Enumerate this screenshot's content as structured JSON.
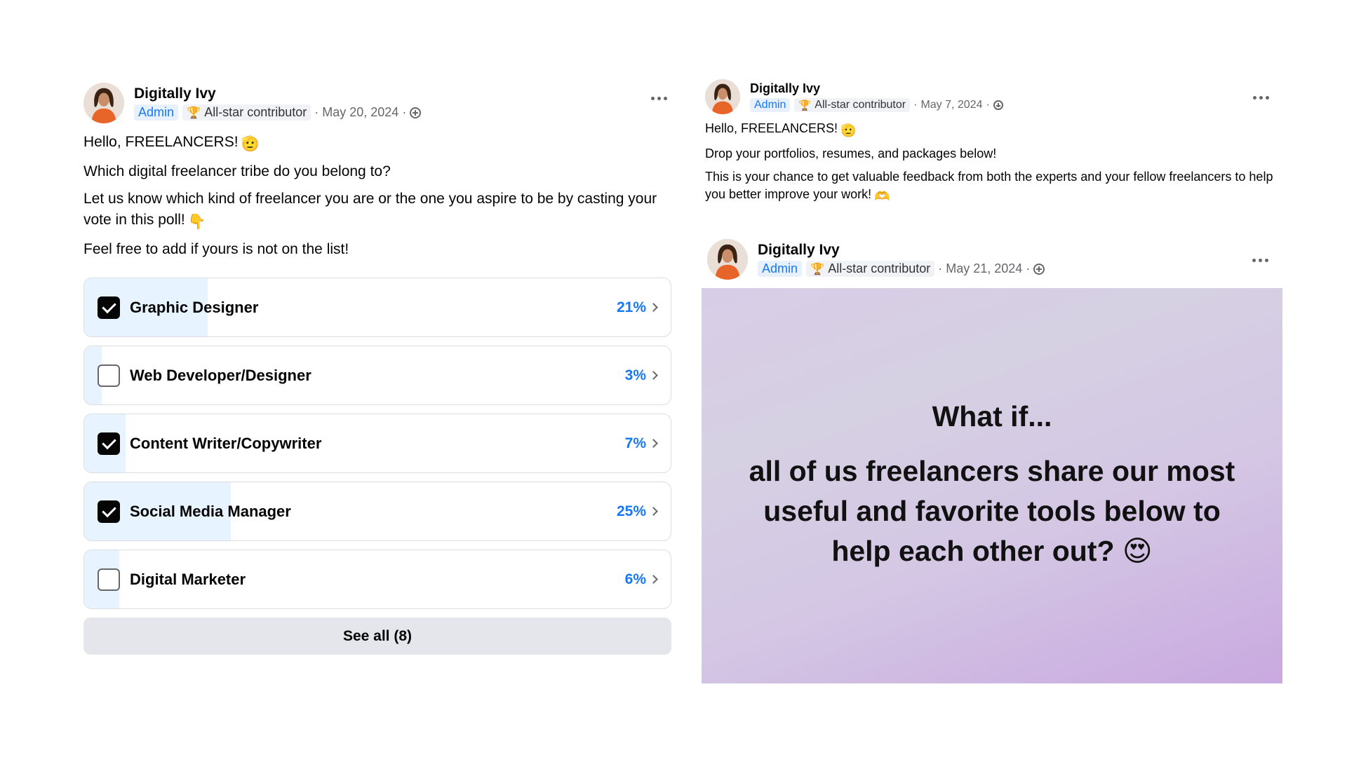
{
  "poll_post": {
    "author": "Digitally Ivy",
    "role_badge": "Admin",
    "contributor_badge": "All-star contributor",
    "date": "May 20, 2024",
    "separator": "·",
    "paragraphs": [
      "Hello, FREELANCERS!",
      "Which digital freelancer tribe do you belong to?",
      "Let us know which kind of freelancer you are or the one you aspire to be by casting your vote in this poll!",
      "Feel free to add if yours is not on the list!"
    ],
    "emoji_1": "🫡",
    "emoji_2": "👇",
    "poll_options": [
      {
        "label": "Graphic Designer",
        "percent_text": "21%",
        "percent": 21,
        "checked": true
      },
      {
        "label": "Web Developer/Designer",
        "percent_text": "3%",
        "percent": 3,
        "checked": false
      },
      {
        "label": "Content Writer/Copywriter",
        "percent_text": "7%",
        "percent": 7,
        "checked": true
      },
      {
        "label": "Social Media Manager",
        "percent_text": "25%",
        "percent": 25,
        "checked": true
      },
      {
        "label": "Digital Marketer",
        "percent_text": "6%",
        "percent": 6,
        "checked": false
      }
    ],
    "see_all_label": "See all (8)"
  },
  "portfolio_post": {
    "author": "Digitally Ivy",
    "role_badge": "Admin",
    "contributor_badge": "All-star contributor",
    "date": "May 7, 2024",
    "separator": "·",
    "paragraphs": [
      "Hello, FREELANCERS!",
      "Drop your portfolios, resumes, and packages below!",
      "This is your chance to get valuable feedback from both the experts and your fellow freelancers to help you better improve your work!"
    ],
    "emoji_1": "🫡",
    "emoji_2": "🫶"
  },
  "tools_post": {
    "author": "Digitally Ivy",
    "role_badge": "Admin",
    "contributor_badge": "All-star contributor",
    "date": "May 21, 2024",
    "separator": "·",
    "card_title": "What if...",
    "card_text": "all of us freelancers share our most useful and favorite tools below to help each other out?",
    "card_emoji": "😍"
  },
  "icons": {
    "trophy": "trophy-icon",
    "globe": "globe-icon",
    "more": "more-options-icon",
    "chevron": "chevron-right-icon"
  },
  "colors": {
    "accent": "#1877f2",
    "poll_fill": "#e7f3ff",
    "muted": "#65676b"
  }
}
